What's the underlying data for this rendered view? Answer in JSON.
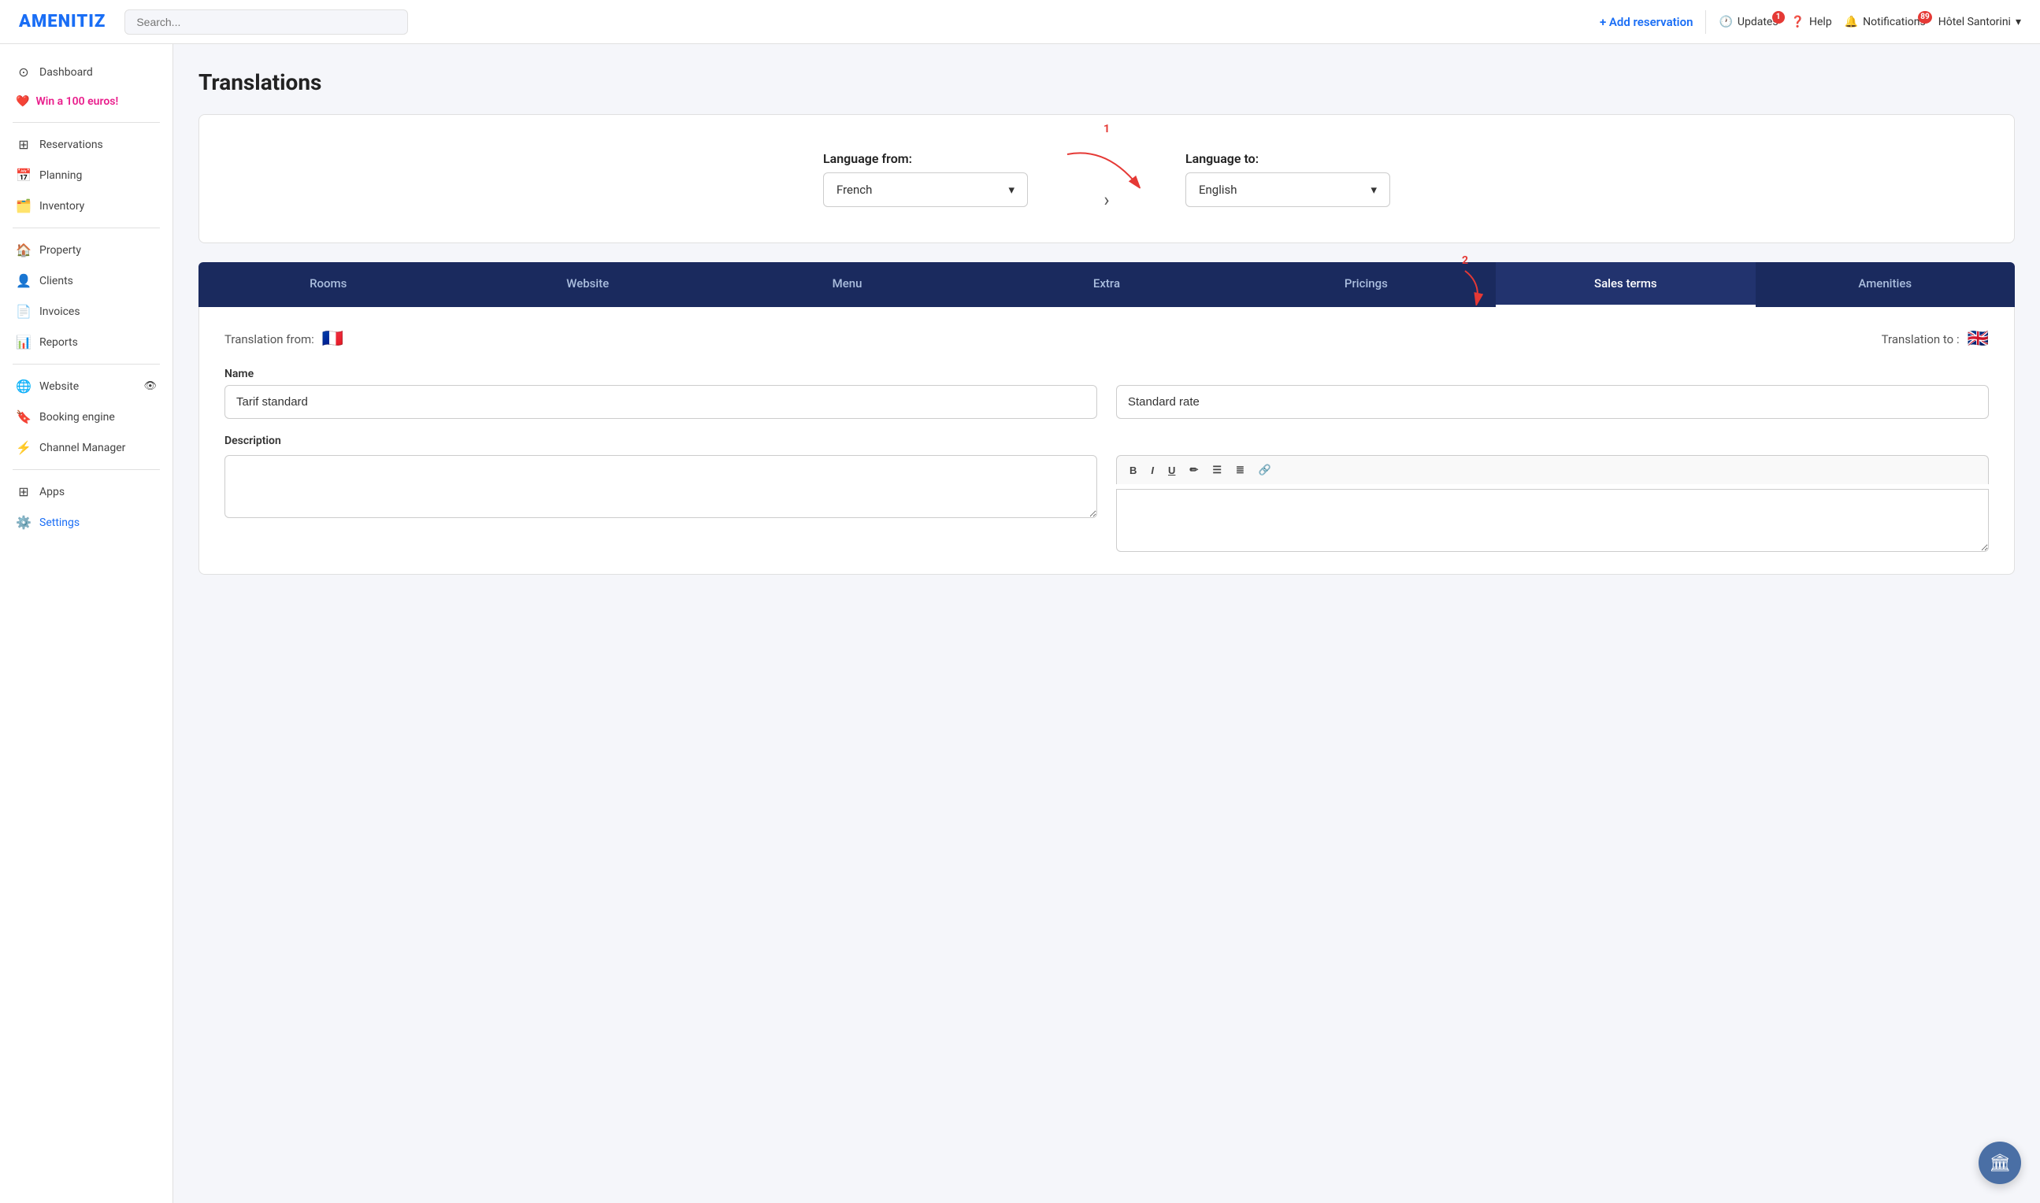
{
  "app": {
    "logo": "AMENITIZ",
    "search_placeholder": "Search...",
    "add_reservation": "+ Add reservation",
    "updates_label": "Updates",
    "updates_badge": "1",
    "help_label": "Help",
    "notifications_label": "Notifications",
    "notifications_badge": "89",
    "hotel_name": "Hôtel Santorini"
  },
  "sidebar": {
    "items": [
      {
        "label": "Dashboard",
        "icon": "⊙"
      },
      {
        "label": "Win a 100 euros!",
        "icon": "❤️",
        "special": "win"
      },
      {
        "label": "Reservations",
        "icon": "⊞"
      },
      {
        "label": "Planning",
        "icon": "📅"
      },
      {
        "label": "Inventory",
        "icon": "🗂️"
      },
      {
        "label": "Property",
        "icon": "🏠"
      },
      {
        "label": "Clients",
        "icon": "👤"
      },
      {
        "label": "Invoices",
        "icon": "📄"
      },
      {
        "label": "Reports",
        "icon": "📊"
      },
      {
        "label": "Website",
        "icon": "🌐"
      },
      {
        "label": "Booking engine",
        "icon": "🔖"
      },
      {
        "label": "Channel Manager",
        "icon": "⚡"
      },
      {
        "label": "Apps",
        "icon": "⊞"
      },
      {
        "label": "Settings",
        "icon": "⚙️",
        "active": true
      }
    ]
  },
  "page": {
    "title": "Translations"
  },
  "language_selector": {
    "from_label": "Language from:",
    "from_value": "French",
    "to_label": "Language to:",
    "to_value": "English",
    "step1": "1",
    "step2": "2"
  },
  "tabs": [
    {
      "label": "Rooms",
      "active": false
    },
    {
      "label": "Website",
      "active": false
    },
    {
      "label": "Menu",
      "active": false
    },
    {
      "label": "Extra",
      "active": false
    },
    {
      "label": "Pricings",
      "active": false
    },
    {
      "label": "Sales terms",
      "active": true
    },
    {
      "label": "Amenities",
      "active": false
    }
  ],
  "translation": {
    "from_label": "Translation from:",
    "from_flag": "🇫🇷",
    "to_label": "Translation to :",
    "to_flag": "🇬🇧"
  },
  "form": {
    "name_label": "Name",
    "name_from_value": "Tarif standard",
    "name_to_value": "Standard rate",
    "desc_label": "Description",
    "toolbar_buttons": [
      "B",
      "I",
      "U",
      "✏",
      "≡",
      "≣",
      "🔗"
    ]
  }
}
